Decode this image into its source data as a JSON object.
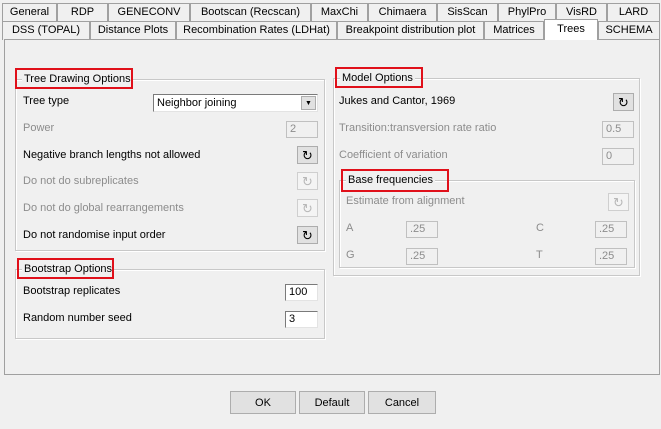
{
  "tabs_row1": [
    "General",
    "RDP",
    "GENECONV",
    "Bootscan (Recscan)",
    "MaxChi",
    "Chimaera",
    "SisScan",
    "PhylPro",
    "VisRD",
    "LARD"
  ],
  "tabs_row2": [
    "DSS (TOPAL)",
    "Distance Plots",
    "Recombination Rates (LDHat)",
    "Breakpoint distribution plot",
    "Matrices",
    "Trees",
    "SCHEMA"
  ],
  "active_tab": "Trees",
  "tree_drawing": {
    "title": "Tree Drawing Options",
    "tree_type_label": "Tree type",
    "tree_type_value": "Neighbor joining",
    "power_label": "Power",
    "power_value": "2",
    "neg_branch_label": "Negative branch lengths not allowed",
    "no_subreplicates_label": "Do not do subreplicates",
    "no_global_rearr_label": "Do not do global rearrangements",
    "no_randomise_label": "Do not randomise input order"
  },
  "bootstrap": {
    "title": "Bootstrap Options",
    "replicates_label": "Bootstrap replicates",
    "replicates_value": "100",
    "seed_label": "Random number seed",
    "seed_value": "3"
  },
  "model": {
    "title": "Model Options",
    "model_name": "Jukes and Cantor, 1969",
    "ti_tv_label": "Transition:transversion rate ratio",
    "ti_tv_value": "0.5",
    "cov_label": "Coefficient of variation",
    "cov_value": "0"
  },
  "base_freq": {
    "title": "Base frequencies",
    "estimate_label": "Estimate from alignment",
    "a_label": "A",
    "a_value": ".25",
    "c_label": "C",
    "c_value": ".25",
    "g_label": "G",
    "g_value": ".25",
    "t_label": "T",
    "t_value": ".25"
  },
  "buttons": {
    "ok": "OK",
    "default": "Default",
    "cancel": "Cancel"
  },
  "icons": {
    "cycle": "refresh-cycle-icon",
    "dropdown": "chevron-down-icon"
  },
  "colors": {
    "highlight": "#e0101a",
    "background": "#f0f0f0"
  }
}
